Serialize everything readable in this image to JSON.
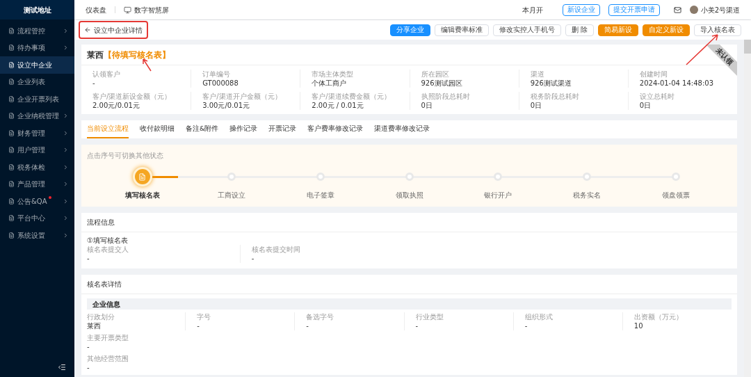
{
  "sidebar": {
    "title": "测试地址",
    "items": [
      {
        "label": "流程管控",
        "arrow": true,
        "badge": false,
        "selected": false
      },
      {
        "label": "待办事项",
        "arrow": true,
        "badge": false,
        "selected": false
      },
      {
        "label": "设立中企业",
        "arrow": false,
        "badge": false,
        "selected": true
      },
      {
        "label": "企业列表",
        "arrow": false,
        "badge": false,
        "selected": false
      },
      {
        "label": "企业开票列表",
        "arrow": false,
        "badge": false,
        "selected": false
      },
      {
        "label": "企业纳税管理",
        "arrow": true,
        "badge": false,
        "selected": false
      },
      {
        "label": "财务管理",
        "arrow": true,
        "badge": false,
        "selected": false
      },
      {
        "label": "用户管理",
        "arrow": true,
        "badge": false,
        "selected": false
      },
      {
        "label": "税务体检",
        "arrow": true,
        "badge": false,
        "selected": false
      },
      {
        "label": "产品管理",
        "arrow": true,
        "badge": false,
        "selected": false
      },
      {
        "label": "公告&QA",
        "arrow": true,
        "badge": true,
        "selected": false
      },
      {
        "label": "平台中心",
        "arrow": true,
        "badge": false,
        "selected": false
      },
      {
        "label": "系统设置",
        "arrow": true,
        "badge": false,
        "selected": false
      }
    ]
  },
  "topbar": {
    "links": [
      "仪表盘",
      "数字智慧屏"
    ],
    "month": "本月开",
    "buttons": [
      "新设企业",
      "提交开票申请"
    ],
    "user": "小美2号渠道"
  },
  "header": {
    "title": "设立中企业详情",
    "actions": [
      {
        "label": "分享企业",
        "kind": "primary"
      },
      {
        "label": "编辑费率标准",
        "kind": "default"
      },
      {
        "label": "修改实控人手机号",
        "kind": "default"
      },
      {
        "label": "删 除",
        "kind": "default"
      },
      {
        "label": "简易新设",
        "kind": "warning"
      },
      {
        "label": "自定义新设",
        "kind": "warning"
      },
      {
        "label": "导入核名表",
        "kind": "default"
      }
    ]
  },
  "company": {
    "name": "莱西",
    "status": "【待填写核名表】",
    "ribbon": "未认领",
    "fields": [
      {
        "label": "认领客户",
        "value": "-"
      },
      {
        "label": "订单编号",
        "value": "GT000088"
      },
      {
        "label": "市场主体类型",
        "value": "个体工商户"
      },
      {
        "label": "所在园区",
        "value": "926测试园区"
      },
      {
        "label": "渠道",
        "value": "926测试渠道"
      },
      {
        "label": "创建时间",
        "value": "2024-01-04 14:48:03"
      },
      {
        "label": "客户/渠道新设金额（元）",
        "value": "2.00元/0.01元"
      },
      {
        "label": "客户/渠道开户金额（元）",
        "value": "3.00元/0.01元"
      },
      {
        "label": "客户/渠道续费金额（元）",
        "value": "2.00元 / 0.01元"
      },
      {
        "label": "执照阶段总耗时",
        "value": "0日"
      },
      {
        "label": "税务阶段总耗时",
        "value": "0日"
      },
      {
        "label": "设立总耗时",
        "value": "0日"
      }
    ]
  },
  "tabs": [
    {
      "label": "当前设立流程",
      "selected": true
    },
    {
      "label": "收付款明细",
      "selected": false
    },
    {
      "label": "备注&附件",
      "selected": false
    },
    {
      "label": "操作记录",
      "selected": false
    },
    {
      "label": "开票记录",
      "selected": false
    },
    {
      "label": "客户费率修改记录",
      "selected": false
    },
    {
      "label": "渠道费率修改记录",
      "selected": false
    }
  ],
  "steps": {
    "hint": "点击序号可切换其他状态",
    "items": [
      {
        "label": "填写核名表",
        "selected": true
      },
      {
        "label": "工商设立",
        "selected": false
      },
      {
        "label": "电子签章",
        "selected": false
      },
      {
        "label": "领取执照",
        "selected": false
      },
      {
        "label": "银行开户",
        "selected": false
      },
      {
        "label": "税务实名",
        "selected": false
      },
      {
        "label": "领盘领票",
        "selected": false
      }
    ]
  },
  "flow_info": {
    "title": "流程信息",
    "step": "①填写核名表",
    "fields": [
      {
        "label": "核名表提交人",
        "value": "-"
      },
      {
        "label": "核名表提交时间",
        "value": "-"
      }
    ]
  },
  "name_form": {
    "title": "核名表详情",
    "section": "企业信息",
    "rows": [
      [
        {
          "label": "行政划分",
          "value": "莱西"
        },
        {
          "label": "字号",
          "value": "-"
        },
        {
          "label": "备选字号",
          "value": "-"
        },
        {
          "label": "行业类型",
          "value": "-"
        },
        {
          "label": "组织形式",
          "value": "-"
        },
        {
          "label": "出资额（万元）",
          "value": "10"
        }
      ],
      [
        {
          "label": "主要开票类型",
          "value": "-"
        }
      ],
      [
        {
          "label": "其他经营范围",
          "value": "-"
        }
      ]
    ]
  }
}
